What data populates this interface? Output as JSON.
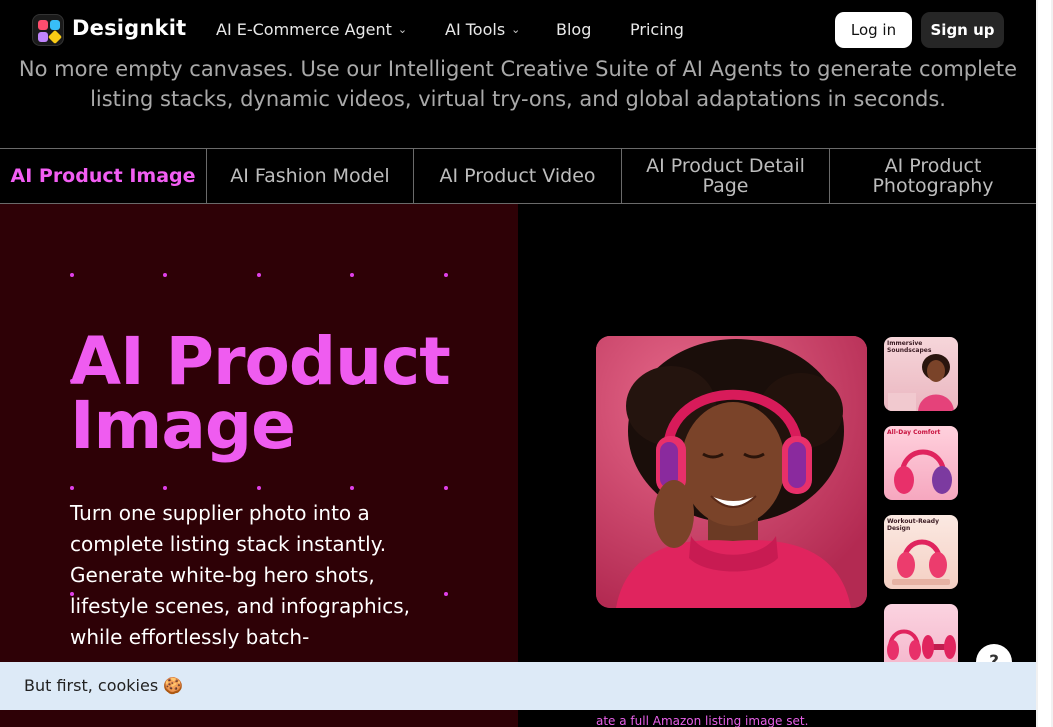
{
  "header": {
    "brand": "Designkit",
    "nav": [
      {
        "label": "AI E-Commerce Agent",
        "dropdown": true
      },
      {
        "label": "AI Tools",
        "dropdown": true
      },
      {
        "label": "Blog",
        "dropdown": false
      },
      {
        "label": "Pricing",
        "dropdown": false
      }
    ],
    "login_label": "Log in",
    "signup_label": "Sign up"
  },
  "subtitle": {
    "line1": "No more empty canvases. Use our Intelligent Creative Suite of AI Agents to generate complete",
    "line2": "listing stacks, dynamic videos, virtual try-ons, and global adaptations in seconds."
  },
  "tabs": [
    {
      "line1": "AI Product Image",
      "line2": "",
      "active": true
    },
    {
      "line1": "AI Fashion Model",
      "line2": "",
      "active": false
    },
    {
      "line1": "AI Product Video",
      "line2": "",
      "active": false
    },
    {
      "line1": "AI Product Detail",
      "line2": "Page",
      "active": false
    },
    {
      "line1": "AI Product",
      "line2": "Photography",
      "active": false
    }
  ],
  "hero": {
    "title_line1": "AI Product",
    "title_line2": "Image",
    "desc": "Turn one supplier photo into a complete listing stack instantly. Generate white-bg hero shots, lifestyle scenes, and infographics, while effortlessly batch-"
  },
  "thumbnails": [
    {
      "caption": "Immersive Soundscapes"
    },
    {
      "caption": "All-Day Comfort"
    },
    {
      "caption": "Workout-Ready Design"
    },
    {
      "caption": ""
    }
  ],
  "bottom_caption": "ate a full Amazon listing image set.",
  "cookie_text": "But first, cookies 🍪",
  "help_label": "?",
  "colors": {
    "accent_pink": "#ef5cf0",
    "hero_bg": "#2e0106",
    "cookie_bg": "#ddeaf7"
  }
}
